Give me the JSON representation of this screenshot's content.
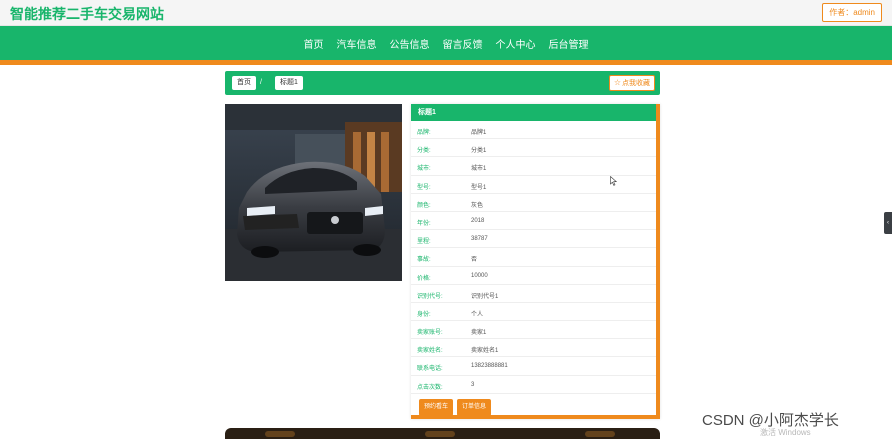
{
  "header": {
    "site_title": "智能推荐二手车交易网站",
    "author_label": "作者：admin"
  },
  "nav": {
    "items": [
      {
        "label": "首页"
      },
      {
        "label": "汽车信息"
      },
      {
        "label": "公告信息"
      },
      {
        "label": "留言反馈"
      },
      {
        "label": "个人中心"
      },
      {
        "label": "后台管理"
      }
    ]
  },
  "breadcrumb": {
    "home": "首页",
    "separator": "/",
    "current": "标题1",
    "favorite_label": "点我收藏"
  },
  "detail": {
    "title": "标题1",
    "fields": [
      {
        "label": "品牌:",
        "value": "品牌1"
      },
      {
        "label": "分类:",
        "value": "分类1"
      },
      {
        "label": "城市:",
        "value": "城市1"
      },
      {
        "label": "型号:",
        "value": "型号1"
      },
      {
        "label": "颜色:",
        "value": "灰色"
      },
      {
        "label": "年份:",
        "value": "2018"
      },
      {
        "label": "里程:",
        "value": "38787"
      },
      {
        "label": "事故:",
        "value": "否"
      },
      {
        "label": "价格:",
        "value": "10000"
      },
      {
        "label": "识别代号:",
        "value": "识别代号1"
      },
      {
        "label": "身份:",
        "value": "个人"
      },
      {
        "label": "卖家账号:",
        "value": "卖家1"
      },
      {
        "label": "卖家姓名:",
        "value": "卖家姓名1"
      },
      {
        "label": "联系电话:",
        "value": "13823888881"
      },
      {
        "label": "点击次数:",
        "value": "3"
      }
    ],
    "buttons": {
      "book": "预约看车",
      "order": "订单信息"
    }
  },
  "overlay": {
    "watermark": "CSDN @小阿杰学长",
    "activate_windows": "激活 Windows"
  },
  "colors": {
    "primary_green": "#18b56b",
    "accent_orange": "#ef8a1d"
  }
}
